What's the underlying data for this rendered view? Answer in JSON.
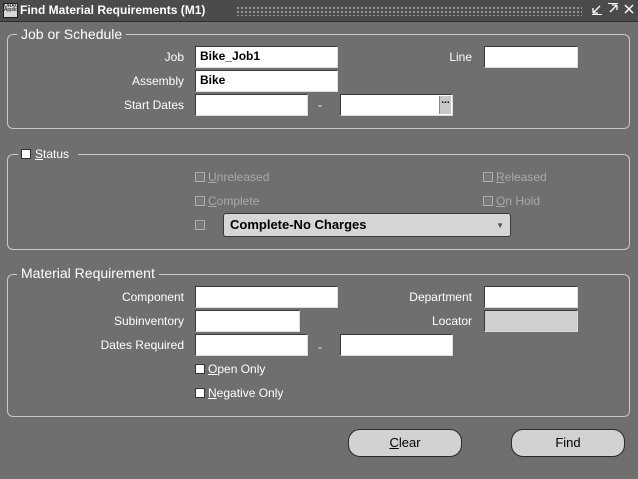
{
  "window": {
    "title": "Find Material Requirements (M1)",
    "controls": [
      "minimize-icon",
      "maximize-icon",
      "close-icon"
    ],
    "app_icon_text": "ORACLE Applications"
  },
  "job_schedule": {
    "legend": "Job or Schedule",
    "job_label": "Job",
    "job_value": "Bike_Job1",
    "line_label": "Line",
    "line_value": "",
    "assembly_label": "Assembly",
    "assembly_value": "Bike",
    "start_dates_label": "Start Dates",
    "start_from": "",
    "separator": "-",
    "start_to": "",
    "lov_glyph": "..."
  },
  "status": {
    "label_u": "S",
    "label_rest": "tatus",
    "unreleased_u": "U",
    "unreleased_rest": "nreleased",
    "released_u": "R",
    "released_rest": "eleased",
    "complete_u": "C",
    "complete_rest": "omplete",
    "on_hold_u": "O",
    "on_hold_rest": "n Hold",
    "select_value": "Complete-No Charges",
    "select_arrow": "▼"
  },
  "material": {
    "legend": "Material Requirement",
    "component_label": "Component",
    "component_value": "",
    "department_label": "Department",
    "department_value": "",
    "subinventory_label": "Subinventory",
    "subinventory_value": "",
    "locator_label": "Locator",
    "locator_value": "",
    "dates_required_label": "Dates Required",
    "dates_from": "",
    "separator": "-",
    "dates_to": "",
    "open_only_u": "O",
    "open_only_rest": "pen Only",
    "negative_only_u": "N",
    "negative_only_rest": "egative Only"
  },
  "buttons": {
    "clear_u": "C",
    "clear_rest": "lear",
    "find": "Find"
  },
  "colors": {
    "background": "#6f6f6f",
    "titlebar": "#4b4b4b",
    "field": "#ffffff",
    "disabled_field": "#cfcfcf"
  }
}
